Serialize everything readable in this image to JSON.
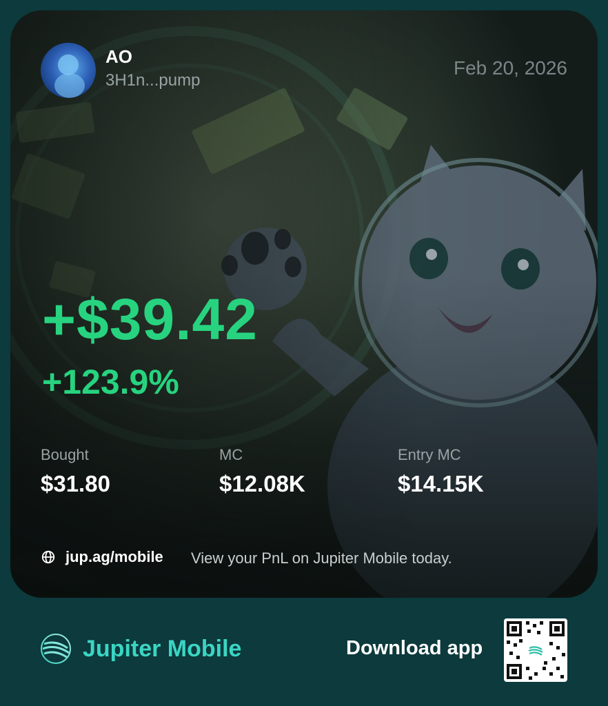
{
  "card": {
    "token": {
      "name": "AO",
      "address": "3H1n...pump"
    },
    "date": "Feb 20, 2026",
    "pnl": "+$39.42",
    "pnl_percent": "+123.9%",
    "stats": [
      {
        "label": "Bought",
        "value": "$31.80"
      },
      {
        "label": "MC",
        "value": "$12.08K"
      },
      {
        "label": "Entry MC",
        "value": "$14.15K"
      }
    ],
    "footer": {
      "link": "jup.ag/mobile",
      "text": "View your PnL on Jupiter Mobile today."
    }
  },
  "bottom": {
    "brand": "Jupiter Mobile",
    "download": "Download app"
  },
  "colors": {
    "profit": "#27d37f",
    "brand": "#3ad6c4",
    "background": "#0c3a3d"
  },
  "icons": [
    "globe-icon",
    "jupiter-logo-icon",
    "qr-code"
  ]
}
